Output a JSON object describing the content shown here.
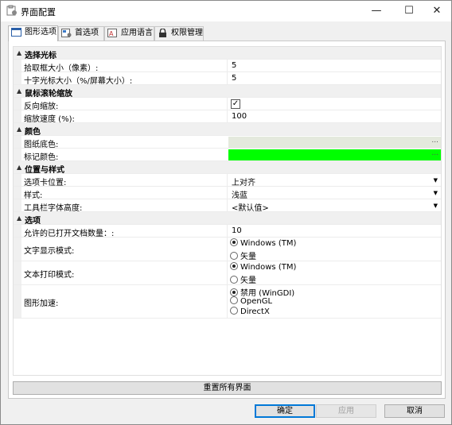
{
  "window": {
    "title": "界面配置",
    "minimize": "—",
    "maximize": "☐",
    "close": "✕"
  },
  "tabs": [
    {
      "label": "图形选项",
      "icon": "window-icon",
      "active": true
    },
    {
      "label": "首选项",
      "icon": "preferences-icon",
      "active": false
    },
    {
      "label": "应用语言",
      "icon": "language-icon",
      "active": false
    },
    {
      "label": "权限管理",
      "icon": "lock-icon",
      "active": false
    }
  ],
  "grid": {
    "cat_cursor": "选择光标",
    "pickbox_label": "拾取框大小（像素）:",
    "pickbox_value": "5",
    "crosshair_label": "十字光标大小（%/屏幕大小）:",
    "crosshair_value": "5",
    "cat_wheel": "鼠标滚轮缩放",
    "reverse_zoom_label": "反向缩放:",
    "reverse_zoom_checked": true,
    "zoom_speed_label": "缩放速度 (%):",
    "zoom_speed_value": "100",
    "cat_color": "颜色",
    "paper_color_label": "图纸底色:",
    "paper_color": "#e4e9dd",
    "marker_color_label": "标记颜色:",
    "marker_color": "#00ff00",
    "ellipsis": "...",
    "cat_position": "位置与样式",
    "tab_position_label": "选项卡位置:",
    "tab_position_value": "上对齐",
    "style_label": "样式:",
    "style_value": "浅蓝",
    "toolbar_font_label": "工具栏字体高度:",
    "toolbar_font_value": "<默认值>",
    "cat_options": "选项",
    "max_docs_label": "允许的已打开文档数量：:",
    "max_docs_value": "10",
    "text_display_label": "文字显示模式:",
    "text_display_options": [
      "Windows (TM)",
      "矢量"
    ],
    "text_display_selected": 0,
    "text_print_label": "文本打印模式:",
    "text_print_options": [
      "Windows (TM)",
      "矢量"
    ],
    "text_print_selected": 0,
    "accel_label": "图形加速:",
    "accel_options": [
      "禁用 (WinGDI)",
      "OpenGL",
      "DirectX"
    ],
    "accel_selected": 0
  },
  "buttons": {
    "reset": "重置所有界面",
    "ok": "确定",
    "apply": "应用",
    "cancel": "取消"
  }
}
